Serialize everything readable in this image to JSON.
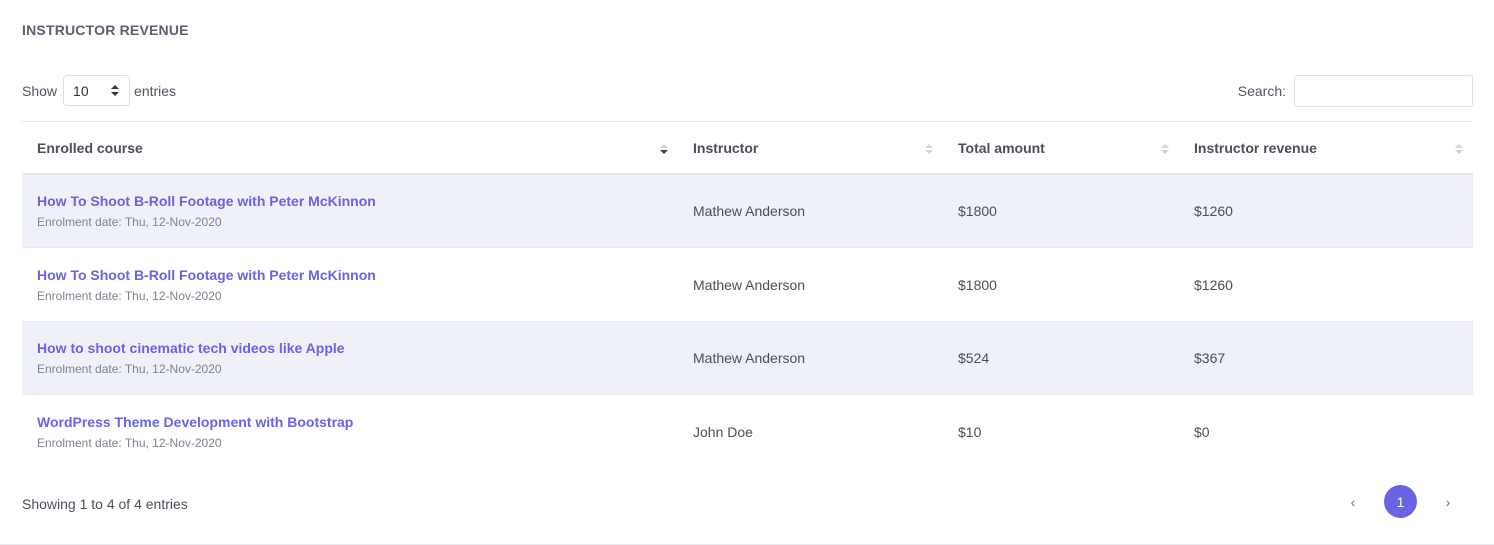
{
  "header": {
    "title": "INSTRUCTOR REVENUE"
  },
  "length": {
    "show_label": "Show",
    "value": "10",
    "entries_label": "entries"
  },
  "search": {
    "label": "Search:",
    "value": "",
    "placeholder": ""
  },
  "table": {
    "columns": [
      "Enrolled course",
      "Instructor",
      "Total amount",
      "Instructor revenue"
    ],
    "rows": [
      {
        "course": "How To Shoot B-Roll Footage with Peter McKinnon",
        "date": "Enrolment date: Thu, 12-Nov-2020",
        "instructor": "Mathew Anderson",
        "total": "$1800",
        "revenue": "$1260"
      },
      {
        "course": "How To Shoot B-Roll Footage with Peter McKinnon",
        "date": "Enrolment date: Thu, 12-Nov-2020",
        "instructor": "Mathew Anderson",
        "total": "$1800",
        "revenue": "$1260"
      },
      {
        "course": "How to shoot cinematic tech videos like Apple",
        "date": "Enrolment date: Thu, 12-Nov-2020",
        "instructor": "Mathew Anderson",
        "total": "$524",
        "revenue": "$367"
      },
      {
        "course": "WordPress Theme Development with Bootstrap",
        "date": "Enrolment date: Thu, 12-Nov-2020",
        "instructor": "John Doe",
        "total": "$10",
        "revenue": "$0"
      }
    ]
  },
  "footer": {
    "info": "Showing 1 to 4 of 4 entries",
    "prev": "‹",
    "page": "1",
    "next": "›"
  },
  "colors": {
    "accent": "#6a63e6",
    "row_stripe": "#eef1f8"
  }
}
